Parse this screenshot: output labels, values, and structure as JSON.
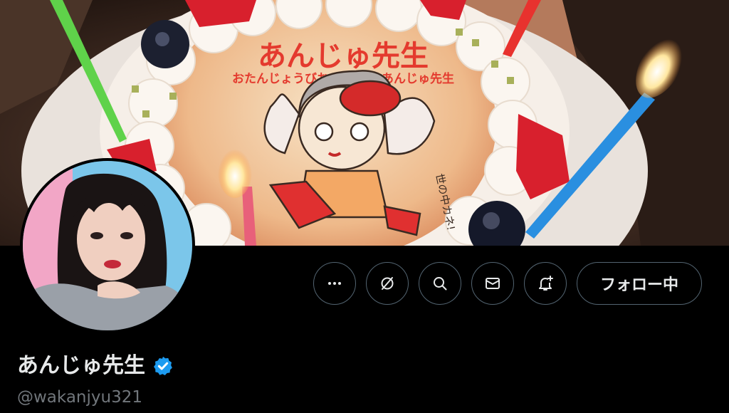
{
  "banner": {
    "cake_title": "あんじゅ先生",
    "cake_message": "おたんじょうびおめでとう あんじゅ先生",
    "cake_note": "世の中カネ!"
  },
  "profile": {
    "display_name": "あんじゅ先生",
    "handle": "@wakanjyu321",
    "verified": true
  },
  "actions": {
    "more_icon": "more-icon",
    "grok_icon": "grok-icon",
    "search_icon": "search-icon",
    "message_icon": "mail-icon",
    "notify_icon": "bell-plus-icon",
    "follow_label": "フォロー中"
  },
  "colors": {
    "background": "#000000",
    "text_primary": "#e7e9ea",
    "text_secondary": "#71767b",
    "border": "#536471",
    "verified_blue": "#1d9bf0"
  }
}
